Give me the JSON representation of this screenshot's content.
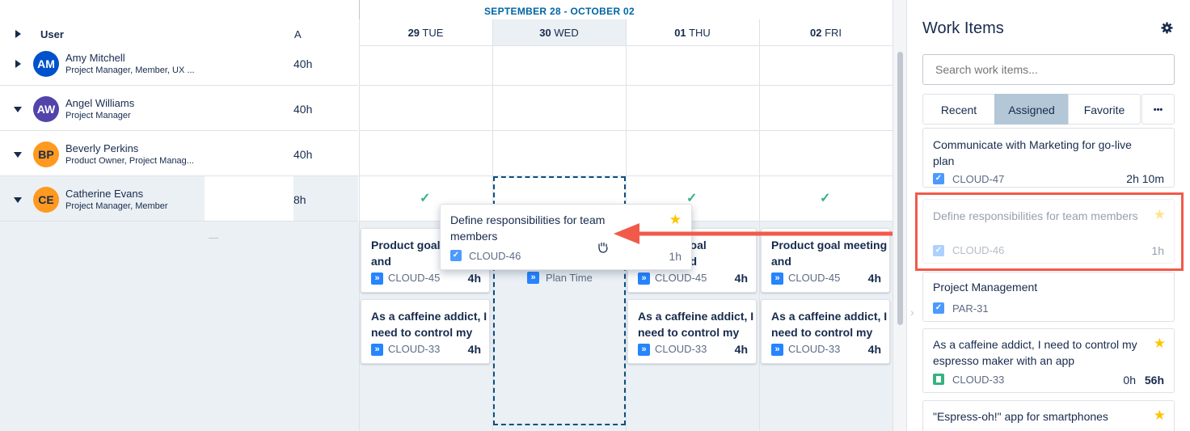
{
  "header": {
    "user_col": "User",
    "avail_col": "A",
    "week_range": "SEPTEMBER 28 - OCTOBER 02",
    "days": [
      {
        "num": "29",
        "name": "TUE"
      },
      {
        "num": "30",
        "name": "WED"
      },
      {
        "num": "01",
        "name": "THU"
      },
      {
        "num": "02",
        "name": "FRI"
      }
    ]
  },
  "users": [
    {
      "initials": "AM",
      "name": "Amy Mitchell",
      "role": "Project Manager, Member, UX ...",
      "hours": "40h",
      "color": "#0052cc"
    },
    {
      "initials": "AW",
      "name": "Angel Williams",
      "role": "Project Manager",
      "hours": "40h",
      "color": "#5243aa"
    },
    {
      "initials": "BP",
      "name": "Beverly Perkins",
      "role": "Product Owner, Project Manag...",
      "hours": "40h",
      "color": "#ff991f"
    },
    {
      "initials": "CE",
      "name": "Catherine Evans",
      "role": "Project Manager, Member",
      "hours": "8h",
      "color": "#ff991f"
    }
  ],
  "checks": [
    "✓",
    "✓",
    "✓"
  ],
  "cards": {
    "product": {
      "title": "Product goal meeting and",
      "key": "CLOUD-45",
      "hours": "4h"
    },
    "product_partial": {
      "title": "goal\nnd",
      "key": "CLOUD-45",
      "hours": "4h"
    },
    "caffeine": {
      "title": "As a caffeine addict, I need to control my",
      "key": "CLOUD-33",
      "hours": "4h"
    },
    "plan_time": "Plan Time"
  },
  "dragged": {
    "title": "Define responsibilities for team members",
    "key": "CLOUD-46",
    "hours": "1h"
  },
  "panel": {
    "title": "Work Items",
    "search_placeholder": "Search work items...",
    "tabs": [
      "Recent",
      "Assigned",
      "Favorite"
    ],
    "more": "•••",
    "items": [
      {
        "title": "Communicate with Marketing for go-live plan",
        "key": "CLOUD-47",
        "hours": "2h 10m"
      },
      {
        "title": "Define responsibilities for team members",
        "key": "CLOUD-46",
        "hours": "1h"
      },
      {
        "title": "Project Management",
        "key": "PAR-31"
      },
      {
        "title": "As a caffeine addict, I need to control my espresso maker with an app",
        "key": "CLOUD-33",
        "logged": "0h",
        "hours": "56h"
      },
      {
        "title": "\"Espress-oh!\" app for smartphones"
      }
    ]
  },
  "colors": {
    "accent": "#0065a3",
    "highlight": "#f15a4a",
    "selected_tab": "#b3c7d6"
  }
}
